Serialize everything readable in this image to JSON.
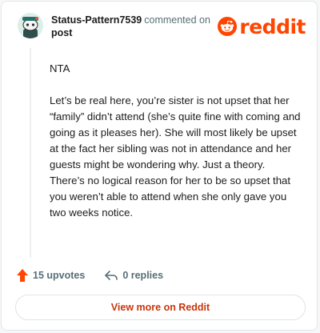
{
  "comment": {
    "username": "Status-Pattern7539",
    "action_text": "commented on",
    "post_link": "post",
    "paragraphs": [
      "NTA",
      "Let’s be real here, you’re sister is not upset that her “family” didn’t attend (she’s quite fine with coming and going as it pleases her). She will most likely be upset at the fact her sibling was not in attendance and her guests might be wondering why. Just a theory. There’s no logical reason for her to be so upset that you weren’t able to attend when she only gave you two weeks notice."
    ],
    "upvotes": "15 upvotes",
    "replies": "0 replies"
  },
  "brand": {
    "wordmark": "reddit",
    "color": "#ff4500"
  },
  "footer": {
    "view_more_label": "View more on Reddit",
    "link_color": "#c8360c"
  },
  "icons": {
    "avatar": "snoo-avatar-icon",
    "logo": "reddit-snoo-icon",
    "upvote": "upvote-arrow-icon",
    "reply": "reply-arrow-icon"
  }
}
